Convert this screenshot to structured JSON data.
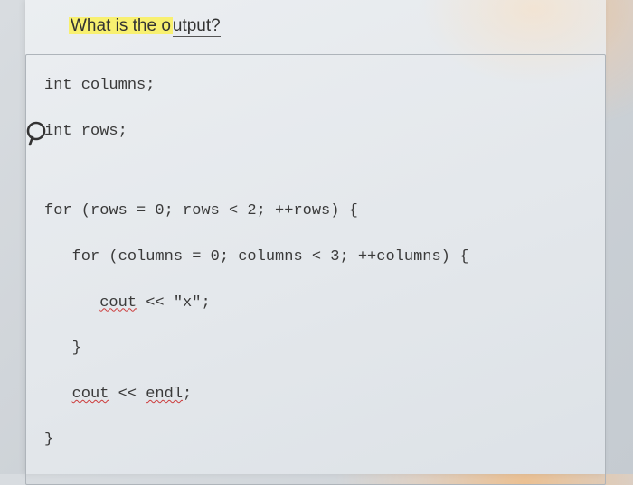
{
  "question": {
    "highlighted": "What is the o",
    "rest": "utput?"
  },
  "code": {
    "l1": "int columns;",
    "l2": "int rows;",
    "l3": "for (rows = 0; rows < 2; ++rows) {",
    "l4": "   for (columns = 0; columns < 3; ++columns) {",
    "l5a": "      ",
    "l5b": "cout",
    "l5c": " << \"x\";",
    "l6": "   }",
    "l7a": "   ",
    "l7b": "cout",
    "l7c": " << ",
    "l7d": "endl",
    "l7e": ";",
    "l8": "}"
  }
}
